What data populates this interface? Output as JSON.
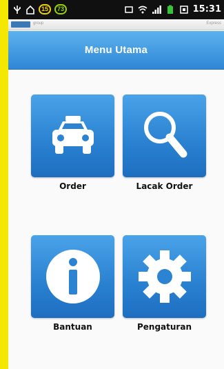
{
  "status_bar": {
    "time": "15:31",
    "badge_1": "15",
    "badge_2": "73"
  },
  "brand": {
    "left_text": "group",
    "right_text": "Express"
  },
  "header": {
    "title": "Menu Utama"
  },
  "menu": {
    "items": [
      {
        "label": "Order",
        "icon": "car-icon"
      },
      {
        "label": "Lacak Order",
        "icon": "search-icon"
      },
      {
        "label": "Bantuan",
        "icon": "info-icon"
      },
      {
        "label": "Pengaturan",
        "icon": "gear-icon"
      }
    ]
  },
  "colors": {
    "frame": "#f5e800",
    "title_bar": "#3a95e0",
    "tile": "#2b83d2"
  }
}
